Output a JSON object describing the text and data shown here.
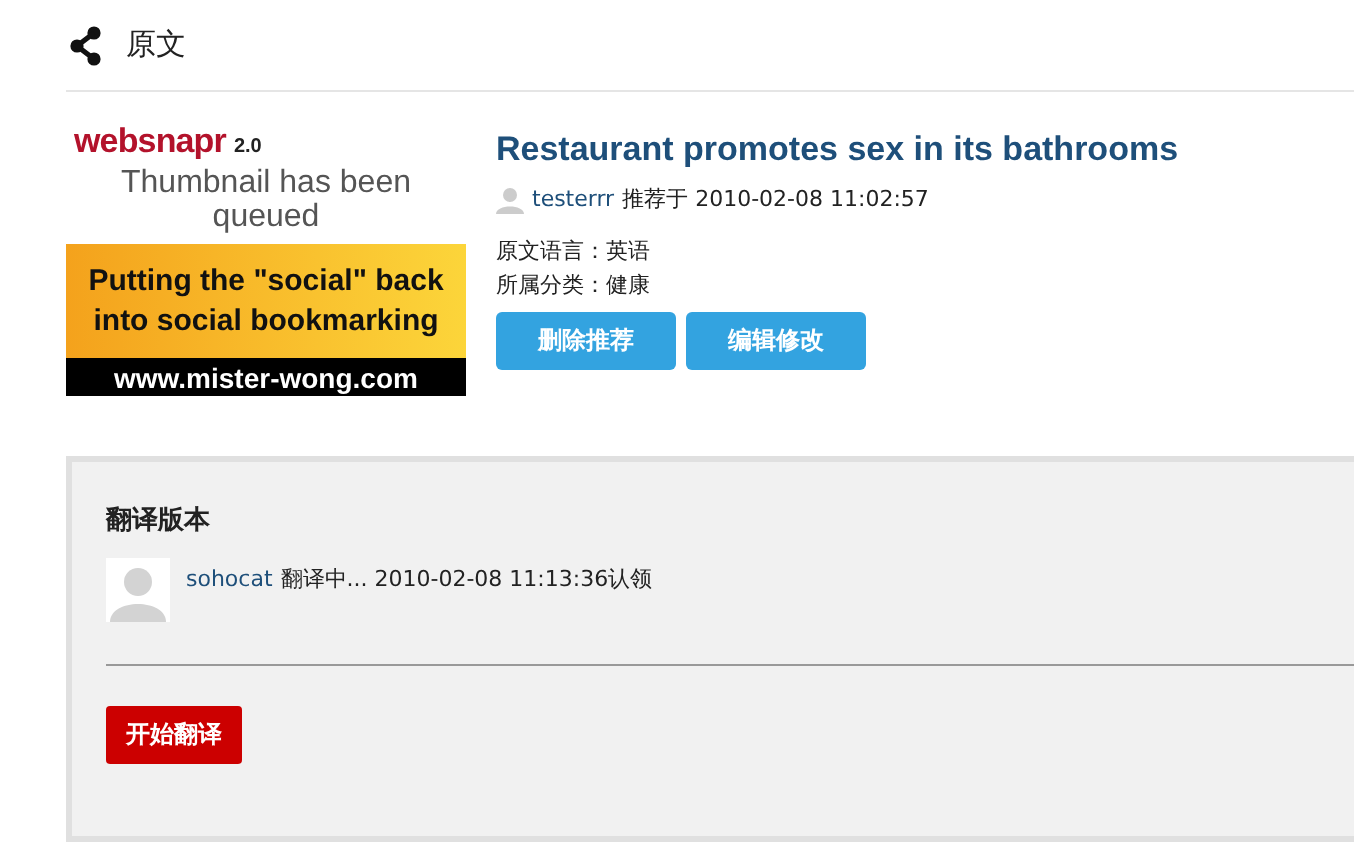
{
  "header": {
    "title": "原文"
  },
  "thumbnail": {
    "brand": "websnapr",
    "version": "2.0",
    "status": "Thumbnail has been queued",
    "banner": "Putting the \"social\" back into social bookmarking",
    "url": "www.mister-wong.com"
  },
  "article": {
    "title": "Restaurant promotes sex in its bathrooms",
    "author": "testerrr",
    "recommended": "推荐于 2010-02-08 11:02:57",
    "language": "原文语言：英语",
    "category": "所属分类：健康"
  },
  "actions": [
    "删除推荐",
    "编辑修改"
  ],
  "translations": {
    "heading": "翻译版本",
    "entries": [
      {
        "user": "sohocat",
        "status": "翻译中... 2010-02-08 11:13:36认领"
      }
    ],
    "start_button": "开始翻译"
  }
}
